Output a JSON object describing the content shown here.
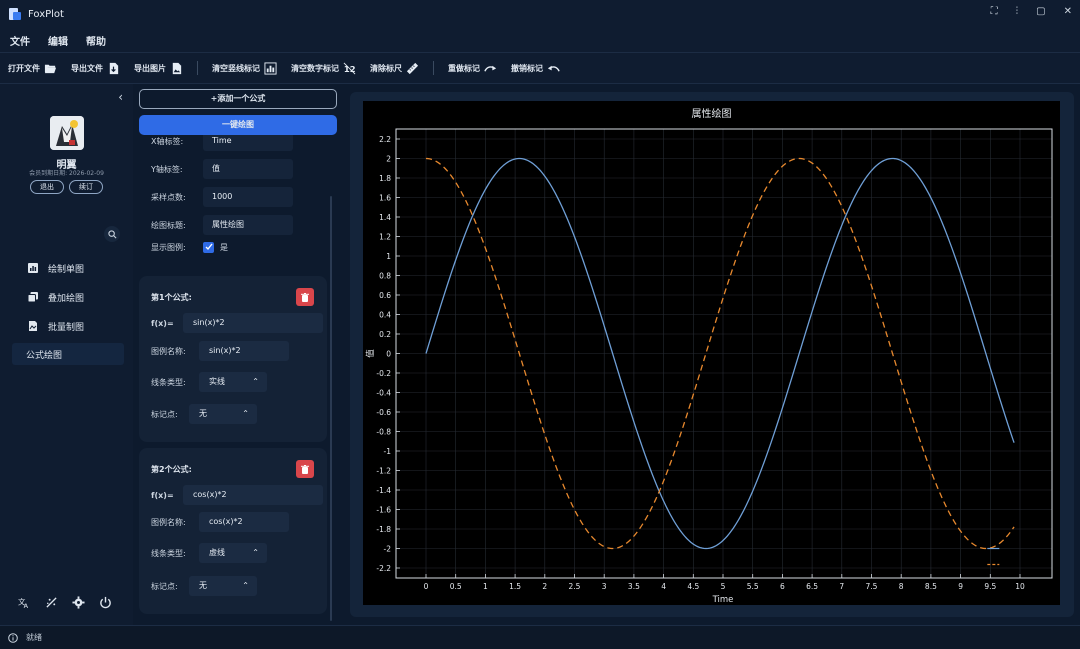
{
  "window": {
    "title": "FoxPlot",
    "controls": [
      "⛶",
      "⫶",
      "▢",
      "✕"
    ]
  },
  "menu": {
    "file": "文件",
    "edit": "编辑",
    "help": "帮助"
  },
  "toolbar": {
    "open_file": "打开文件",
    "export_file": "导出文件",
    "export_image": "导出图片",
    "clear_vline": "清空竖线标记",
    "clear_num": "清空数字标记",
    "clear_ruler": "清除标尺",
    "redo": "重做标记",
    "undo": "撤销标记"
  },
  "sidebar": {
    "collapse": "‹",
    "user_name": "明翼",
    "expire": "会员到期日期:  2026-02-09",
    "logout": "退出",
    "renew": "续订",
    "nav": [
      {
        "label": "绘制单图",
        "icon": "bar-chart-icon"
      },
      {
        "label": "叠加绘图",
        "icon": "overlay-icon"
      },
      {
        "label": "批量制图",
        "icon": "batch-icon"
      },
      {
        "label": "公式绘图",
        "icon": ""
      }
    ]
  },
  "panel": {
    "add_formula": "+添加一个公式",
    "one_click": "一键绘图",
    "settings": {
      "x_label_label": "X轴标签:",
      "x_label_value": "Time",
      "y_label_label": "Y轴标签:",
      "y_label_value": "值",
      "samples_label": "采样点数:",
      "samples_value": "1000",
      "title_label": "绘图标题:",
      "title_value": "属性绘图",
      "legend_label": "显示图例:",
      "legend_value": "是"
    },
    "formulas": [
      {
        "title": "第1个公式:",
        "fx_label": "f(x)=",
        "fx_value": "sin(x)*2",
        "legend_label": "图例名称:",
        "legend_value": "sin(x)*2",
        "line_label": "线条类型:",
        "line_value": "实线",
        "marker_label": "标记点:",
        "marker_value": "无"
      },
      {
        "title": "第2个公式:",
        "fx_label": "f(x)=",
        "fx_value": "cos(x)*2",
        "legend_label": "图例名称:",
        "legend_value": "cos(x)*2",
        "line_label": "线条类型:",
        "line_value": "虚线",
        "marker_label": "标记点:",
        "marker_value": "无"
      }
    ]
  },
  "status": {
    "text": "就绪"
  },
  "colors": {
    "accent": "#2f6be6",
    "sin": "#6f9fd6",
    "cos": "#e8892e",
    "danger": "#d9464b"
  },
  "chart_data": {
    "type": "line",
    "title": "属性绘图",
    "xlabel": "Time",
    "ylabel": "值",
    "xlim": [
      0,
      9.9
    ],
    "ylim": [
      -2.2,
      2.2
    ],
    "xticks": [
      0,
      0.5,
      1,
      1.5,
      2,
      2.5,
      3,
      3.5,
      4,
      4.5,
      5,
      5.5,
      6,
      6.5,
      7,
      7.5,
      8,
      8.5,
      9,
      9.5,
      10
    ],
    "yticks": [
      -2.2,
      -2,
      -1.8,
      -1.6,
      -1.4,
      -1.2,
      -1,
      -0.8,
      -0.6,
      -0.4,
      -0.2,
      0,
      0.2,
      0.4,
      0.6,
      0.8,
      1,
      1.2,
      1.4,
      1.6,
      1.8,
      2,
      2.2
    ],
    "grid": true,
    "series": [
      {
        "name": "sin(x)*2",
        "formula": "sin(x)*2",
        "style": "solid",
        "color": "#6f9fd6",
        "x_range": [
          0,
          9.9
        ],
        "samples": 1000
      },
      {
        "name": "cos(x)*2",
        "formula": "cos(x)*2",
        "style": "dashed",
        "color": "#e8892e",
        "x_range": [
          0,
          9.9
        ],
        "samples": 1000
      }
    ],
    "legend": "bottom-right"
  }
}
